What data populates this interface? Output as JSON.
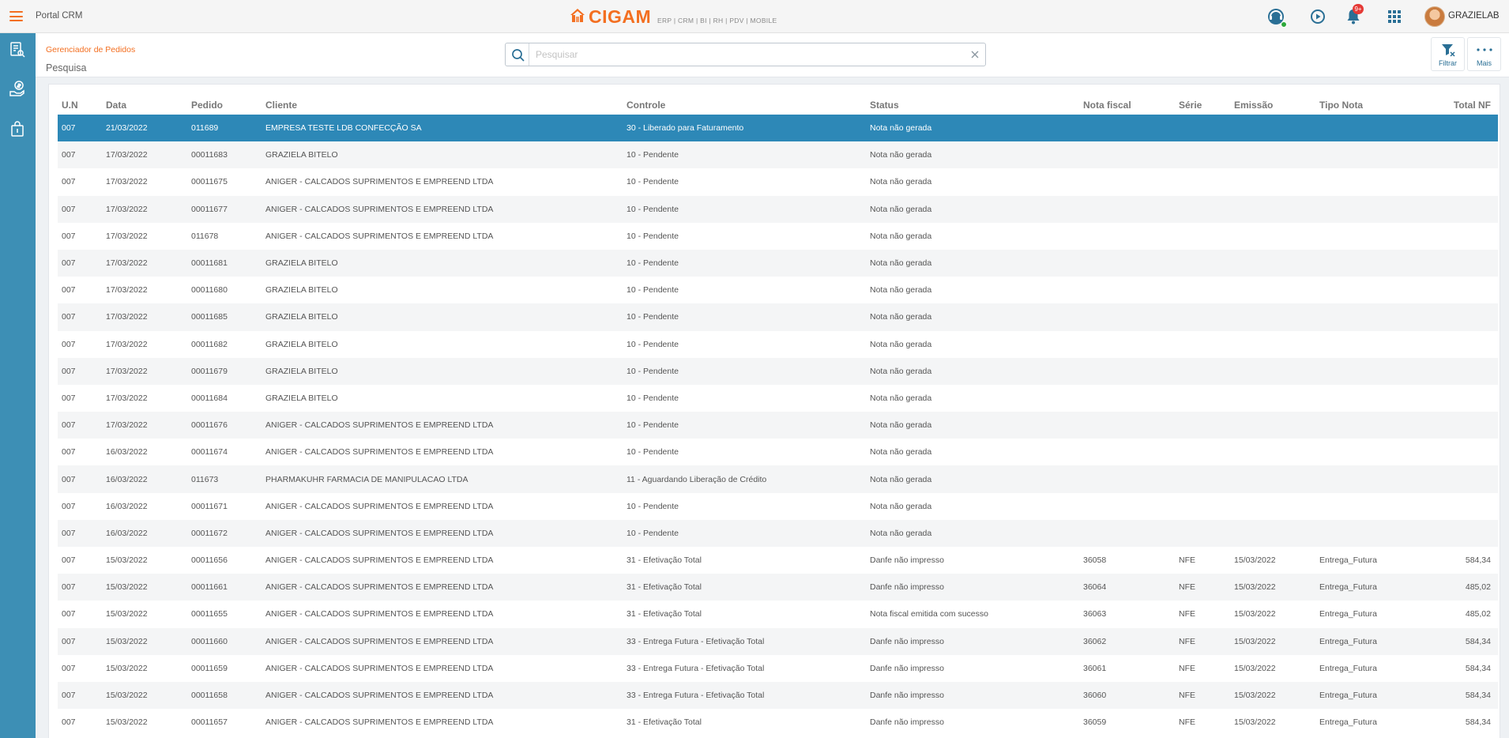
{
  "topbar": {
    "app_title": "Portal CRM",
    "brand_name": "CIGAM",
    "brand_tagline": "ERP | CRM | BI | RH | PDV | MOBILE",
    "notification_count": "9+",
    "user_name": "GRAZIELAB"
  },
  "sidenav": {
    "items": [
      "reports-icon",
      "finance-icon",
      "bag-icon"
    ]
  },
  "header": {
    "breadcrumb": "Gerenciador de Pedidos",
    "page_title": "Pesquisa",
    "search": {
      "value": "",
      "placeholder": "Pesquisar"
    },
    "filter_label": "Filtrar",
    "more_label": "Mais"
  },
  "colors": {
    "accent": "#f36f21",
    "primary": "#3d8fb5",
    "selected_row": "#2d88b7"
  },
  "table": {
    "columns": [
      "U.N",
      "Data",
      "Pedido",
      "Cliente",
      "Controle",
      "Status",
      "Nota fiscal",
      "Série",
      "Emissão",
      "Tipo Nota",
      "Total NF"
    ],
    "selected_index": 0,
    "rows": [
      [
        "007",
        "21/03/2022",
        "011689",
        "EMPRESA TESTE LDB CONFECÇÃO SA",
        "30 - Liberado para Faturamento",
        "Nota não gerada",
        "",
        "",
        "",
        "",
        ""
      ],
      [
        "007",
        "17/03/2022",
        "00011683",
        "GRAZIELA BITELO",
        "10 - Pendente",
        "Nota não gerada",
        "",
        "",
        "",
        "",
        ""
      ],
      [
        "007",
        "17/03/2022",
        "00011675",
        "ANIGER - CALCADOS SUPRIMENTOS E EMPREEND LTDA",
        "10 - Pendente",
        "Nota não gerada",
        "",
        "",
        "",
        "",
        ""
      ],
      [
        "007",
        "17/03/2022",
        "00011677",
        "ANIGER - CALCADOS SUPRIMENTOS E EMPREEND LTDA",
        "10 - Pendente",
        "Nota não gerada",
        "",
        "",
        "",
        "",
        ""
      ],
      [
        "007",
        "17/03/2022",
        "011678",
        "ANIGER - CALCADOS SUPRIMENTOS E EMPREEND LTDA",
        "10 - Pendente",
        "Nota não gerada",
        "",
        "",
        "",
        "",
        ""
      ],
      [
        "007",
        "17/03/2022",
        "00011681",
        "GRAZIELA BITELO",
        "10 - Pendente",
        "Nota não gerada",
        "",
        "",
        "",
        "",
        ""
      ],
      [
        "007",
        "17/03/2022",
        "00011680",
        "GRAZIELA BITELO",
        "10 - Pendente",
        "Nota não gerada",
        "",
        "",
        "",
        "",
        ""
      ],
      [
        "007",
        "17/03/2022",
        "00011685",
        "GRAZIELA BITELO",
        "10 - Pendente",
        "Nota não gerada",
        "",
        "",
        "",
        "",
        ""
      ],
      [
        "007",
        "17/03/2022",
        "00011682",
        "GRAZIELA BITELO",
        "10 - Pendente",
        "Nota não gerada",
        "",
        "",
        "",
        "",
        ""
      ],
      [
        "007",
        "17/03/2022",
        "00011679",
        "GRAZIELA BITELO",
        "10 - Pendente",
        "Nota não gerada",
        "",
        "",
        "",
        "",
        ""
      ],
      [
        "007",
        "17/03/2022",
        "00011684",
        "GRAZIELA BITELO",
        "10 - Pendente",
        "Nota não gerada",
        "",
        "",
        "",
        "",
        ""
      ],
      [
        "007",
        "17/03/2022",
        "00011676",
        "ANIGER - CALCADOS SUPRIMENTOS E EMPREEND LTDA",
        "10 - Pendente",
        "Nota não gerada",
        "",
        "",
        "",
        "",
        ""
      ],
      [
        "007",
        "16/03/2022",
        "00011674",
        "ANIGER - CALCADOS SUPRIMENTOS E EMPREEND LTDA",
        "10 - Pendente",
        "Nota não gerada",
        "",
        "",
        "",
        "",
        ""
      ],
      [
        "007",
        "16/03/2022",
        "011673",
        "PHARMAKUHR FARMACIA DE MANIPULACAO LTDA",
        "11 - Aguardando Liberação de Crédito",
        "Nota não gerada",
        "",
        "",
        "",
        "",
        ""
      ],
      [
        "007",
        "16/03/2022",
        "00011671",
        "ANIGER - CALCADOS SUPRIMENTOS E EMPREEND LTDA",
        "10 - Pendente",
        "Nota não gerada",
        "",
        "",
        "",
        "",
        ""
      ],
      [
        "007",
        "16/03/2022",
        "00011672",
        "ANIGER - CALCADOS SUPRIMENTOS E EMPREEND LTDA",
        "10 - Pendente",
        "Nota não gerada",
        "",
        "",
        "",
        "",
        ""
      ],
      [
        "007",
        "15/03/2022",
        "00011656",
        "ANIGER - CALCADOS SUPRIMENTOS E EMPREEND LTDA",
        "31 - Efetivação Total",
        "Danfe não impresso",
        "36058",
        "NFE",
        "15/03/2022",
        "Entrega_Futura",
        "584,34"
      ],
      [
        "007",
        "15/03/2022",
        "00011661",
        "ANIGER - CALCADOS SUPRIMENTOS E EMPREEND LTDA",
        "31 - Efetivação Total",
        "Danfe não impresso",
        "36064",
        "NFE",
        "15/03/2022",
        "Entrega_Futura",
        "485,02"
      ],
      [
        "007",
        "15/03/2022",
        "00011655",
        "ANIGER - CALCADOS SUPRIMENTOS E EMPREEND LTDA",
        "31 - Efetivação Total",
        "Nota fiscal emitida com sucesso",
        "36063",
        "NFE",
        "15/03/2022",
        "Entrega_Futura",
        "485,02"
      ],
      [
        "007",
        "15/03/2022",
        "00011660",
        "ANIGER - CALCADOS SUPRIMENTOS E EMPREEND LTDA",
        "33 - Entrega Futura - Efetivação Total",
        "Danfe não impresso",
        "36062",
        "NFE",
        "15/03/2022",
        "Entrega_Futura",
        "584,34"
      ],
      [
        "007",
        "15/03/2022",
        "00011659",
        "ANIGER - CALCADOS SUPRIMENTOS E EMPREEND LTDA",
        "33 - Entrega Futura - Efetivação Total",
        "Danfe não impresso",
        "36061",
        "NFE",
        "15/03/2022",
        "Entrega_Futura",
        "584,34"
      ],
      [
        "007",
        "15/03/2022",
        "00011658",
        "ANIGER - CALCADOS SUPRIMENTOS E EMPREEND LTDA",
        "33 - Entrega Futura - Efetivação Total",
        "Danfe não impresso",
        "36060",
        "NFE",
        "15/03/2022",
        "Entrega_Futura",
        "584,34"
      ],
      [
        "007",
        "15/03/2022",
        "00011657",
        "ANIGER - CALCADOS SUPRIMENTOS E EMPREEND LTDA",
        "31 - Efetivação Total",
        "Danfe não impresso",
        "36059",
        "NFE",
        "15/03/2022",
        "Entrega_Futura",
        "584,34"
      ]
    ]
  }
}
